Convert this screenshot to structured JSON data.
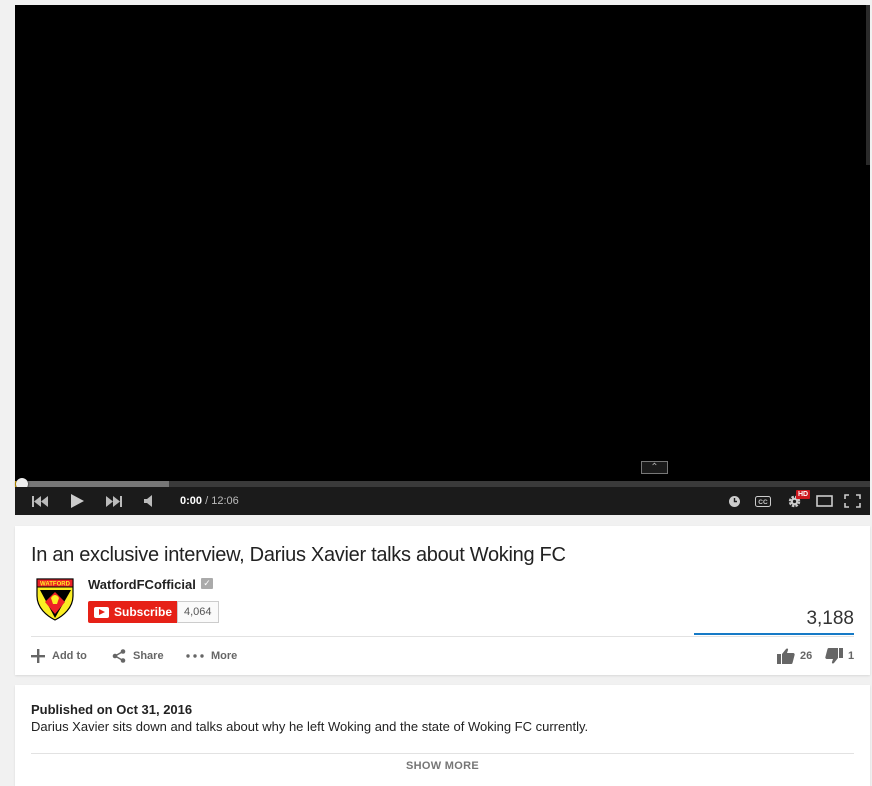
{
  "player": {
    "current_time": "0:00",
    "duration": "/ 12:06",
    "played_fraction": 0.012,
    "buffered_fraction": 0.18,
    "hd_badge": "HD",
    "cc_label": "CC",
    "icons": [
      "previous-icon",
      "play-icon",
      "next-icon",
      "volume-icon",
      "watch-later-icon",
      "captions-icon",
      "settings-icon",
      "theater-mode-icon",
      "fullscreen-icon"
    ]
  },
  "video": {
    "title": "In an exclusive interview, Darius Xavier talks about Woking FC",
    "view_count": "3,188",
    "likes": "26",
    "dislikes": "1"
  },
  "channel": {
    "name": "WatfordFCofficial",
    "crest_text": "WATFORD",
    "subscribe_label": "Subscribe",
    "subscriber_count": "4,064"
  },
  "actions": {
    "add_to": "Add to",
    "share": "Share",
    "more": "More"
  },
  "description": {
    "published": "Published on Oct 31, 2016",
    "text": "Darius Xavier sits down and talks about why he left Woking and the state of Woking FC currently.",
    "show_more": "SHOW MORE"
  },
  "colors": {
    "subscribe_red": "#e62117",
    "progress_played": "#e8b200",
    "view_bar_blue": "#167ac6"
  }
}
